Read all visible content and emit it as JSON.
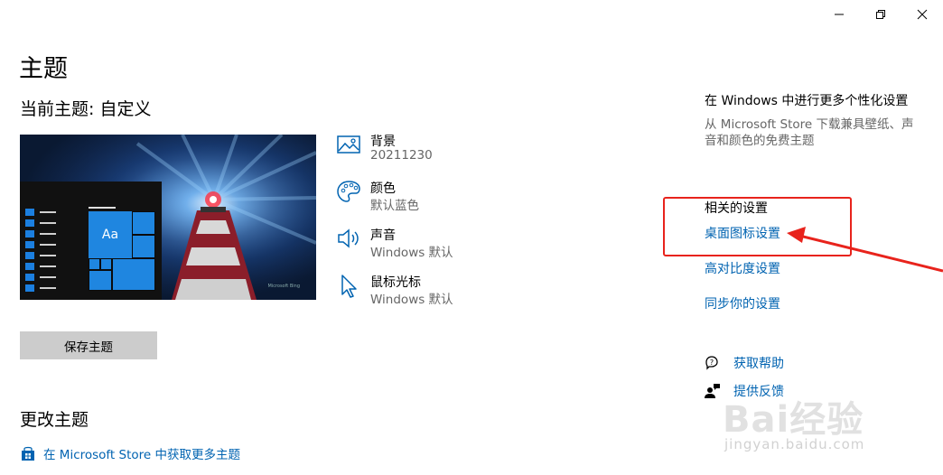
{
  "window": {
    "minimize_icon": "minimize-icon",
    "restore_icon": "restore-icon",
    "close_icon": "close-icon"
  },
  "page_title": "主题",
  "current_theme_label": "当前主题: 自定义",
  "preview": {
    "tile_text": "Aa",
    "brand_mark": "Microsoft Bing"
  },
  "attributes": [
    {
      "icon": "picture-icon",
      "title": "背景",
      "value": "20211230"
    },
    {
      "icon": "palette-icon",
      "title": "颜色",
      "value": "默认蓝色"
    },
    {
      "icon": "speaker-icon",
      "title": "声音",
      "value": "Windows 默认"
    },
    {
      "icon": "cursor-icon",
      "title": "鼠标光标",
      "value": "Windows 默认"
    }
  ],
  "save_button": "保存主题",
  "change_theme_heading": "更改主题",
  "store_link": "在 Microsoft Store 中获取更多主题",
  "right": {
    "personalize_title": "在 Windows 中进行更多个性化设置",
    "personalize_desc": "从 Microsoft Store 下载兼具壁纸、声音和颜色的免费主题",
    "related_title": "相关的设置",
    "links": [
      "桌面图标设置",
      "高对比度设置",
      "同步你的设置"
    ],
    "help": "获取帮助",
    "feedback": "提供反馈"
  },
  "watermark": {
    "logo": "Bai经验",
    "url": "jingyan.baidu.com"
  },
  "colors": {
    "link": "#0063b1",
    "accent": "#1f86e0",
    "annotation": "#e8231c"
  }
}
